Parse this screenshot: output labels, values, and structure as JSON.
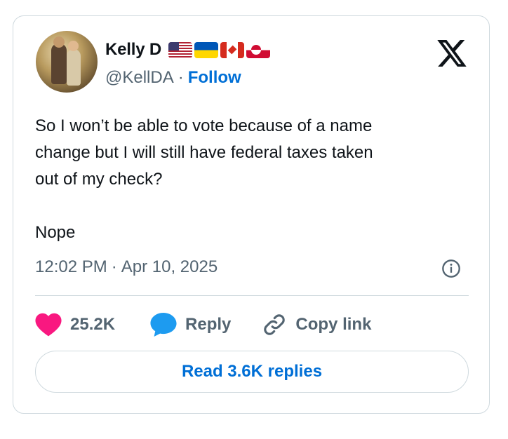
{
  "author": {
    "name": "Kelly D",
    "flags": [
      "us-flag-icon",
      "ukraine-flag-icon",
      "canada-flag-icon",
      "greenland-flag-icon"
    ],
    "handle": "@KellDA",
    "separator": "·",
    "follow_label": "Follow"
  },
  "platform": {
    "logo": "x-logo-icon"
  },
  "tweet": {
    "text": "So I won’t be able to vote because of a name\nchange but I will still have federal taxes taken\nout of my check?\n\nNope",
    "time": "12:02 PM",
    "meta_separator": "·",
    "date": "Apr 10, 2025"
  },
  "actions": {
    "likes": "25.2K",
    "reply_label": "Reply",
    "copy_link_label": "Copy link"
  },
  "replies_button": {
    "label": "Read 3.6K replies"
  },
  "colors": {
    "accent": "#006fd6",
    "like_heart": "#f91880",
    "reply_bubble": "#1d9bf0",
    "muted_text": "#536471",
    "border": "#cfd9de"
  }
}
